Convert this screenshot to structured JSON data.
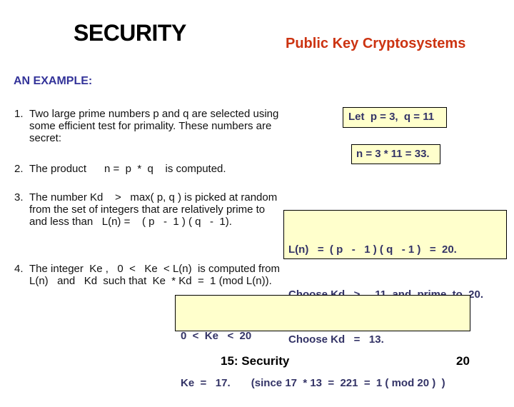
{
  "header": {
    "title": "SECURITY",
    "subtitle": "Public Key Cryptosystems"
  },
  "section_heading": "AN EXAMPLE:",
  "steps": [
    {
      "number": "1.",
      "lines": [
        "Two large prime numbers p and q are selected using",
        "some efficient test for primality. These numbers are",
        "secret:"
      ]
    },
    {
      "number": "2.",
      "lines": [
        "The product      n =  p  *  q    is computed."
      ]
    },
    {
      "number": "3.",
      "lines": [
        "The number Kd    >   max( p, q ) is picked at random",
        "from the set of integers that are relatively prime to",
        "and less than   L(n) =    ( p   -  1 ) ( q   -  1)."
      ]
    },
    {
      "number": "4.",
      "lines": [
        "The integer  Ke ,   0  <   Ke  < L(n)  is computed from",
        "L(n)   and   Kd  such that  Ke  * Kd  =  1 (mod L(n))."
      ]
    }
  ],
  "callouts": {
    "primes": "Let  p = 3,  q = 11",
    "product": "n = 3 * 11 = 33.",
    "choose_kd": [
      "L(n)   =  ( p   -   1 ) ( q   - 1 )   =  20.",
      "Choose Kd   >     11  and  prime  to  20.",
      "Choose Kd   =   13."
    ],
    "compute_ke": [
      "0  <  Ke   <  20",
      "Ke  =   17.       (since 17  * 13  =  221  =  1 ( mod 20 )  )"
    ]
  },
  "footer": {
    "chapter": "15: Security",
    "page_number": "20"
  }
}
